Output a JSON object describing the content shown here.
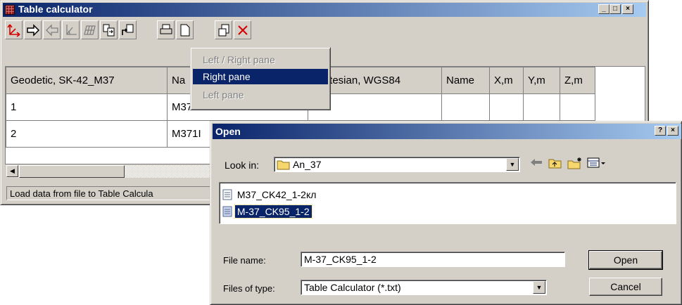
{
  "window": {
    "title": "Table calculator",
    "controls": {
      "minimize": "_",
      "maximize": "□",
      "close": "×"
    }
  },
  "toolbar": {
    "buttons": [
      {
        "name": "axes-icon",
        "color": "#d40000"
      },
      {
        "name": "arrow-right-icon",
        "color": "#000000"
      },
      {
        "name": "arrow-left-icon",
        "color": "#808080"
      },
      {
        "name": "coordinate-transform-icon",
        "color": "#808080"
      },
      {
        "name": "grid-transform-icon",
        "color": "#808080"
      },
      {
        "name": "copy-right-icon",
        "color": "#000000"
      },
      {
        "name": "load-file-icon",
        "color": "#000000"
      },
      {
        "name": "print-icon",
        "color": "#000000"
      },
      {
        "name": "new-icon",
        "color": "#000000"
      },
      {
        "name": "save-icon",
        "color": "#000000"
      },
      {
        "name": "delete-icon",
        "color": "#d40000"
      }
    ]
  },
  "dropdown_menu": {
    "items": [
      {
        "label": "Left / Right pane",
        "state": "disabled"
      },
      {
        "label": "Right pane",
        "state": "active"
      },
      {
        "label": "Left pane",
        "state": "disabled"
      }
    ]
  },
  "grid": {
    "headers": [
      "Geodetic, SK-42_M37",
      "Na",
      "Cartesian, WGS84",
      "Name",
      "X,m",
      "Y,m",
      "Z,m"
    ],
    "rows": [
      [
        "1",
        "M3710110015151 0",
        "1",
        "",
        "",
        "",
        ""
      ],
      [
        "2",
        "M371I",
        "",
        "",
        "",
        "",
        ""
      ]
    ]
  },
  "statusbar": {
    "text": "Load data from file to Table Calcula"
  },
  "open_dialog": {
    "title": "Open",
    "help": "?",
    "close": "×",
    "look_in_label": "Look in:",
    "look_in_value": "An_37",
    "files": [
      {
        "name": "M37_CK42_1-2кл",
        "selected": false
      },
      {
        "name": "M-37_CK95_1-2",
        "selected": true
      }
    ],
    "file_name_label": "File name:",
    "file_name_value": "M-37_CK95_1-2",
    "file_type_label": "Files of type:",
    "file_type_value": "Table Calculator (*.txt)",
    "open_button": "Open",
    "cancel_button": "Cancel"
  },
  "colors": {
    "title_bar_start": "#0a246a",
    "title_bar_end": "#a6caf0",
    "face": "#d4d0c8",
    "selection": "#0a246a",
    "folder": "#f5d76e"
  }
}
